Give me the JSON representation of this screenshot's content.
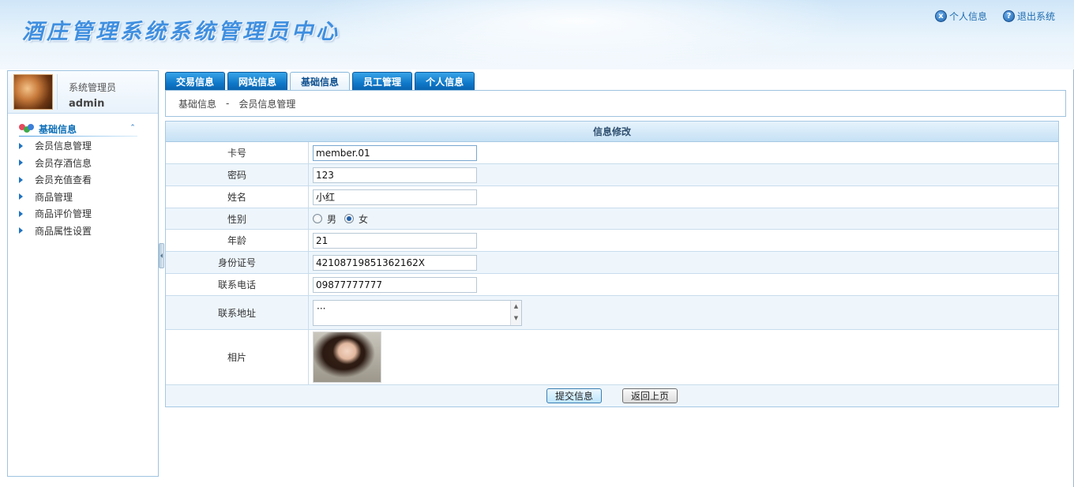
{
  "header": {
    "title": "酒庄管理系统系统管理员中心",
    "links": [
      {
        "label": "个人信息",
        "icon": "x"
      },
      {
        "label": "退出系统",
        "icon": "?"
      }
    ]
  },
  "user": {
    "role": "系统管理员",
    "name": "admin"
  },
  "sidebar": {
    "section_title": "基础信息",
    "items": [
      {
        "label": "会员信息管理"
      },
      {
        "label": "会员存酒信息"
      },
      {
        "label": "会员充值查看"
      },
      {
        "label": "商品管理"
      },
      {
        "label": "商品评价管理"
      },
      {
        "label": "商品属性设置"
      }
    ]
  },
  "tabs": [
    {
      "label": "交易信息"
    },
    {
      "label": "网站信息"
    },
    {
      "label": "基础信息",
      "active": true
    },
    {
      "label": "员工管理"
    },
    {
      "label": "个人信息"
    }
  ],
  "breadcrumb": {
    "section": "基础信息",
    "separator": "-",
    "page": "会员信息管理"
  },
  "form": {
    "title": "信息修改",
    "fields": {
      "card_label": "卡号",
      "card_value": "member.01",
      "password_label": "密码",
      "password_value": "123",
      "name_label": "姓名",
      "name_value": "小红",
      "gender_label": "性别",
      "gender_male": "男",
      "gender_female": "女",
      "gender_selected": "女",
      "age_label": "年龄",
      "age_value": "21",
      "id_label": "身份证号",
      "id_value": "42108719851362162X",
      "phone_label": "联系电话",
      "phone_value": "09877777777",
      "address_label": "联系地址",
      "address_value": "···",
      "photo_label": "相片"
    },
    "submit_label": "提交信息",
    "back_label": "返回上页"
  }
}
